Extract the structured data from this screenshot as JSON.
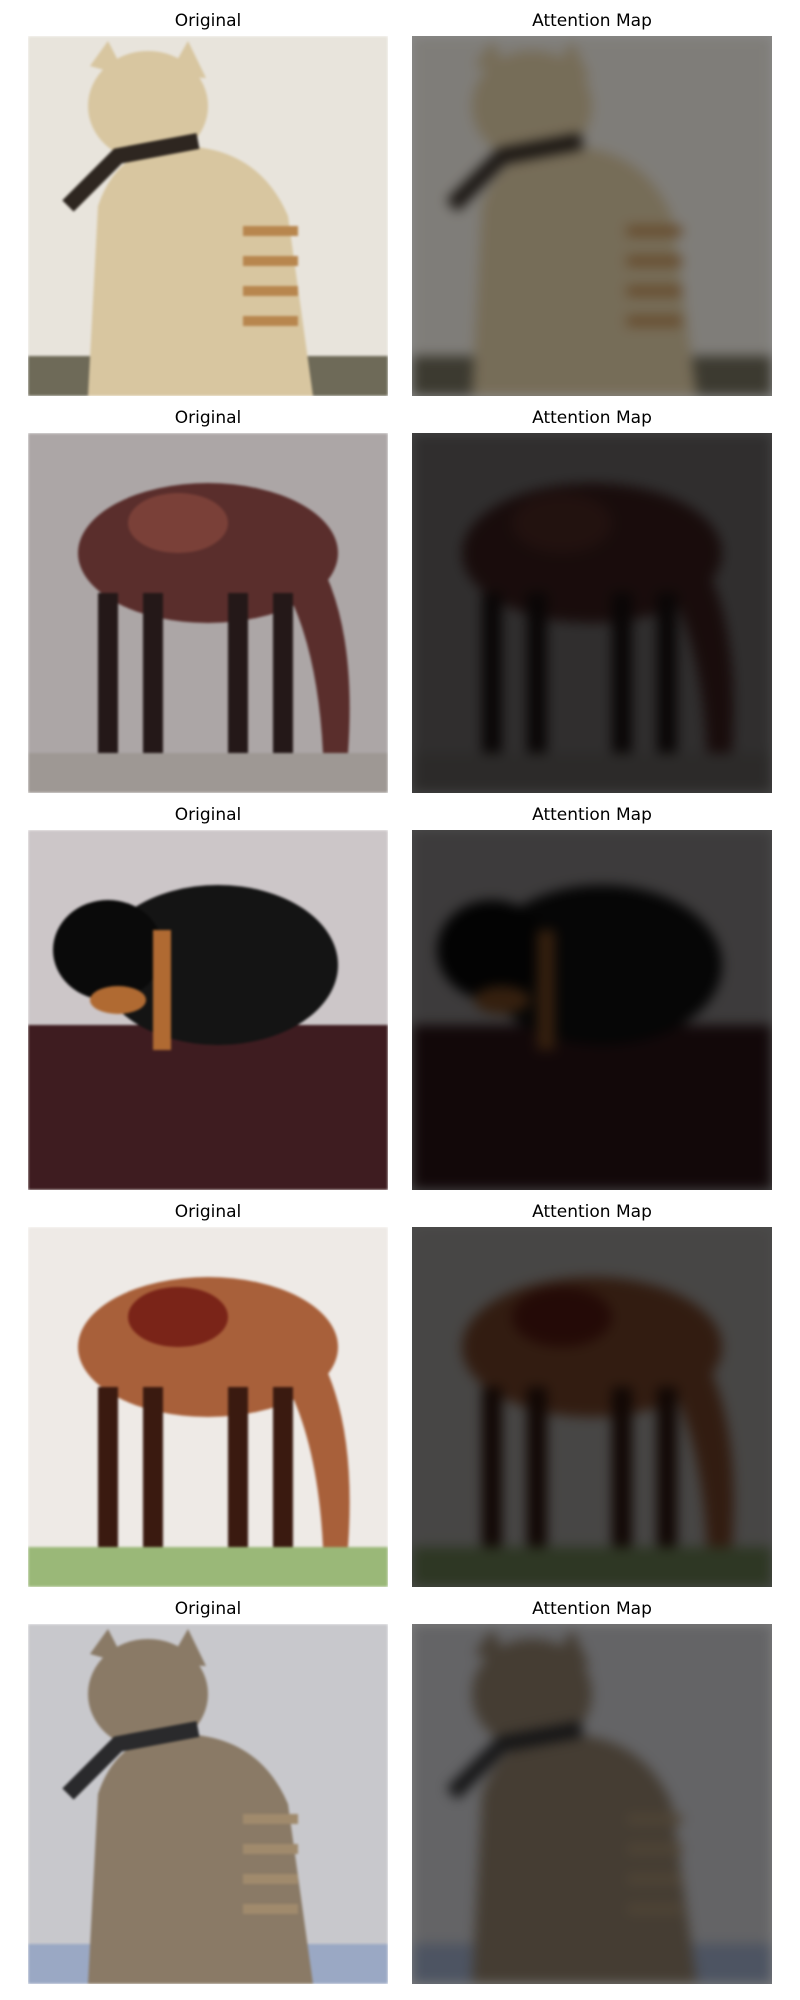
{
  "figure": {
    "rows": [
      {
        "original_title": "Original",
        "attention_title": "Attention Map",
        "subject": "cat",
        "colors": {
          "background": "#e8e4dc",
          "body": "#d8c6a0",
          "accent": "#b8864e",
          "dark": "#2e2620",
          "floor": "#6e6a58"
        },
        "attention_brightness": 0.55
      },
      {
        "original_title": "Original",
        "attention_title": "Attention Map",
        "subject": "horse",
        "colors": {
          "background": "#aca6a6",
          "body": "#5a2e2c",
          "accent": "#7a4038",
          "dark": "#241818",
          "floor": "#9e9894"
        },
        "attention_brightness": 0.28
      },
      {
        "original_title": "Original",
        "attention_title": "Attention Map",
        "subject": "dog",
        "colors": {
          "background": "#ccc6c8",
          "body": "#141414",
          "accent": "#b06a32",
          "dark": "#0a0a0a",
          "floor": "#3e1c20"
        },
        "attention_brightness": 0.3
      },
      {
        "original_title": "Original",
        "attention_title": "Attention Map",
        "subject": "horse",
        "colors": {
          "background": "#eeeae6",
          "body": "#a8603a",
          "accent": "#7a2418",
          "dark": "#3a1a10",
          "floor": "#9ab878"
        },
        "attention_brightness": 0.3
      },
      {
        "original_title": "Original",
        "attention_title": "Attention Map",
        "subject": "cat",
        "colors": {
          "background": "#c8c8cc",
          "body": "#8a7a66",
          "accent": "#a08a6c",
          "dark": "#2a2a2c",
          "floor": "#9aa8c4"
        },
        "attention_brightness": 0.5
      }
    ]
  }
}
